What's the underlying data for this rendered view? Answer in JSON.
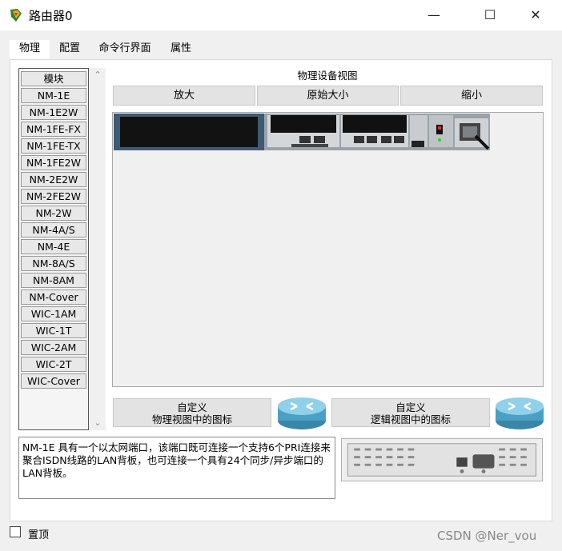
{
  "window": {
    "title": "路由器0",
    "minimize": "—",
    "maximize": "☐",
    "close": "✕"
  },
  "tabs": [
    "物理",
    "配置",
    "命令行界面",
    "属性"
  ],
  "modules": [
    "模块",
    "NM-1E",
    "NM-1E2W",
    "NM-1FE-FX",
    "NM-1FE-TX",
    "NM-1FE2W",
    "NM-2E2W",
    "NM-2FE2W",
    "NM-2W",
    "NM-4A/S",
    "NM-4E",
    "NM-8A/S",
    "NM-8AM",
    "NM-Cover",
    "WIC-1AM",
    "WIC-1T",
    "WIC-2AM",
    "WIC-2T",
    "WIC-Cover"
  ],
  "physical_view": {
    "title": "物理设备视图",
    "zoom_in": "放大",
    "original_size": "原始大小",
    "zoom_out": "缩小"
  },
  "custom": {
    "physical": [
      "自定义",
      "物理视图中的图标"
    ],
    "logical": [
      "自定义",
      "逻辑视图中的图标"
    ]
  },
  "description": "NM-1E 具有一个以太网端口，该端口既可连接一个支持6个PRI连接来聚合ISDN线路的LAN背板，也可连接一个具有24个同步/异步端口的LAN背板。",
  "pin_label": "置顶",
  "watermark": "CSDN @Ner_vou"
}
